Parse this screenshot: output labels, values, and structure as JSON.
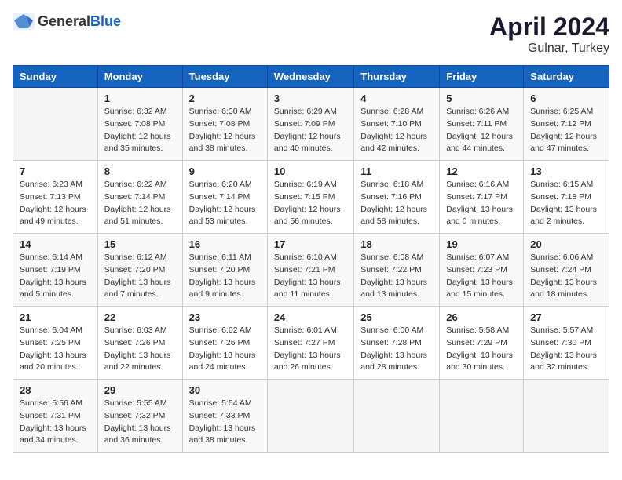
{
  "header": {
    "logo_general": "General",
    "logo_blue": "Blue",
    "title": "April 2024",
    "subtitle": "Gulnar, Turkey"
  },
  "columns": [
    "Sunday",
    "Monday",
    "Tuesday",
    "Wednesday",
    "Thursday",
    "Friday",
    "Saturday"
  ],
  "weeks": [
    [
      {
        "day": "",
        "info": ""
      },
      {
        "day": "1",
        "info": "Sunrise: 6:32 AM\nSunset: 7:08 PM\nDaylight: 12 hours\nand 35 minutes."
      },
      {
        "day": "2",
        "info": "Sunrise: 6:30 AM\nSunset: 7:08 PM\nDaylight: 12 hours\nand 38 minutes."
      },
      {
        "day": "3",
        "info": "Sunrise: 6:29 AM\nSunset: 7:09 PM\nDaylight: 12 hours\nand 40 minutes."
      },
      {
        "day": "4",
        "info": "Sunrise: 6:28 AM\nSunset: 7:10 PM\nDaylight: 12 hours\nand 42 minutes."
      },
      {
        "day": "5",
        "info": "Sunrise: 6:26 AM\nSunset: 7:11 PM\nDaylight: 12 hours\nand 44 minutes."
      },
      {
        "day": "6",
        "info": "Sunrise: 6:25 AM\nSunset: 7:12 PM\nDaylight: 12 hours\nand 47 minutes."
      }
    ],
    [
      {
        "day": "7",
        "info": "Sunrise: 6:23 AM\nSunset: 7:13 PM\nDaylight: 12 hours\nand 49 minutes."
      },
      {
        "day": "8",
        "info": "Sunrise: 6:22 AM\nSunset: 7:14 PM\nDaylight: 12 hours\nand 51 minutes."
      },
      {
        "day": "9",
        "info": "Sunrise: 6:20 AM\nSunset: 7:14 PM\nDaylight: 12 hours\nand 53 minutes."
      },
      {
        "day": "10",
        "info": "Sunrise: 6:19 AM\nSunset: 7:15 PM\nDaylight: 12 hours\nand 56 minutes."
      },
      {
        "day": "11",
        "info": "Sunrise: 6:18 AM\nSunset: 7:16 PM\nDaylight: 12 hours\nand 58 minutes."
      },
      {
        "day": "12",
        "info": "Sunrise: 6:16 AM\nSunset: 7:17 PM\nDaylight: 13 hours\nand 0 minutes."
      },
      {
        "day": "13",
        "info": "Sunrise: 6:15 AM\nSunset: 7:18 PM\nDaylight: 13 hours\nand 2 minutes."
      }
    ],
    [
      {
        "day": "14",
        "info": "Sunrise: 6:14 AM\nSunset: 7:19 PM\nDaylight: 13 hours\nand 5 minutes."
      },
      {
        "day": "15",
        "info": "Sunrise: 6:12 AM\nSunset: 7:20 PM\nDaylight: 13 hours\nand 7 minutes."
      },
      {
        "day": "16",
        "info": "Sunrise: 6:11 AM\nSunset: 7:20 PM\nDaylight: 13 hours\nand 9 minutes."
      },
      {
        "day": "17",
        "info": "Sunrise: 6:10 AM\nSunset: 7:21 PM\nDaylight: 13 hours\nand 11 minutes."
      },
      {
        "day": "18",
        "info": "Sunrise: 6:08 AM\nSunset: 7:22 PM\nDaylight: 13 hours\nand 13 minutes."
      },
      {
        "day": "19",
        "info": "Sunrise: 6:07 AM\nSunset: 7:23 PM\nDaylight: 13 hours\nand 15 minutes."
      },
      {
        "day": "20",
        "info": "Sunrise: 6:06 AM\nSunset: 7:24 PM\nDaylight: 13 hours\nand 18 minutes."
      }
    ],
    [
      {
        "day": "21",
        "info": "Sunrise: 6:04 AM\nSunset: 7:25 PM\nDaylight: 13 hours\nand 20 minutes."
      },
      {
        "day": "22",
        "info": "Sunrise: 6:03 AM\nSunset: 7:26 PM\nDaylight: 13 hours\nand 22 minutes."
      },
      {
        "day": "23",
        "info": "Sunrise: 6:02 AM\nSunset: 7:26 PM\nDaylight: 13 hours\nand 24 minutes."
      },
      {
        "day": "24",
        "info": "Sunrise: 6:01 AM\nSunset: 7:27 PM\nDaylight: 13 hours\nand 26 minutes."
      },
      {
        "day": "25",
        "info": "Sunrise: 6:00 AM\nSunset: 7:28 PM\nDaylight: 13 hours\nand 28 minutes."
      },
      {
        "day": "26",
        "info": "Sunrise: 5:58 AM\nSunset: 7:29 PM\nDaylight: 13 hours\nand 30 minutes."
      },
      {
        "day": "27",
        "info": "Sunrise: 5:57 AM\nSunset: 7:30 PM\nDaylight: 13 hours\nand 32 minutes."
      }
    ],
    [
      {
        "day": "28",
        "info": "Sunrise: 5:56 AM\nSunset: 7:31 PM\nDaylight: 13 hours\nand 34 minutes."
      },
      {
        "day": "29",
        "info": "Sunrise: 5:55 AM\nSunset: 7:32 PM\nDaylight: 13 hours\nand 36 minutes."
      },
      {
        "day": "30",
        "info": "Sunrise: 5:54 AM\nSunset: 7:33 PM\nDaylight: 13 hours\nand 38 minutes."
      },
      {
        "day": "",
        "info": ""
      },
      {
        "day": "",
        "info": ""
      },
      {
        "day": "",
        "info": ""
      },
      {
        "day": "",
        "info": ""
      }
    ]
  ]
}
